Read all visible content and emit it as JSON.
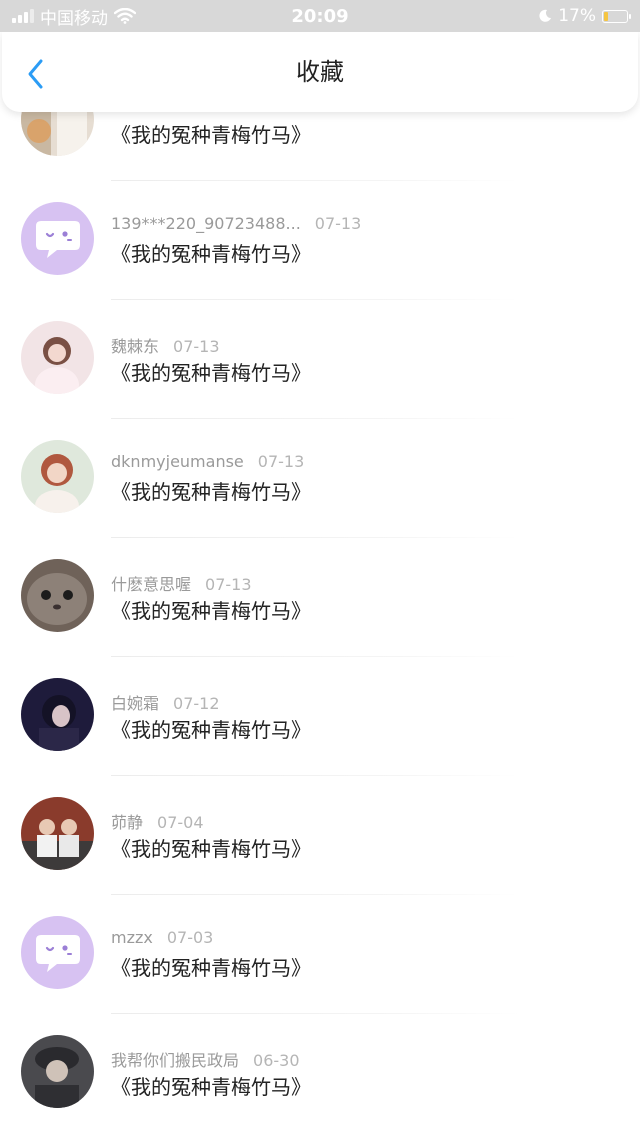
{
  "status": {
    "carrier": "中国移动",
    "time": "20:09",
    "battery": "17%",
    "battery_level": 0.17
  },
  "header": {
    "title": "收藏"
  },
  "items": [
    {
      "user": "",
      "date": "",
      "title": "《我的冤种青梅竹马》"
    },
    {
      "user": "139***220_90723488...",
      "date": "07-13",
      "title": "《我的冤种青梅竹马》"
    },
    {
      "user": "魏棘东",
      "date": "07-13",
      "title": "《我的冤种青梅竹马》"
    },
    {
      "user": "dknmyjeumanse",
      "date": "07-13",
      "title": "《我的冤种青梅竹马》"
    },
    {
      "user": "什麽意思喔",
      "date": "07-13",
      "title": "《我的冤种青梅竹马》"
    },
    {
      "user": "白婉霜",
      "date": "07-12",
      "title": "《我的冤种青梅竹马》"
    },
    {
      "user": "茆静",
      "date": "07-04",
      "title": "《我的冤种青梅竹马》"
    },
    {
      "user": "mzzx",
      "date": "07-03",
      "title": "《我的冤种青梅竹马》"
    },
    {
      "user": "我帮你们搬民政局",
      "date": "06-30",
      "title": "《我的冤种青梅竹马》"
    }
  ],
  "colors": {
    "accent": "#2b9cf5",
    "bubble_avatar": "#d7c2f2"
  }
}
